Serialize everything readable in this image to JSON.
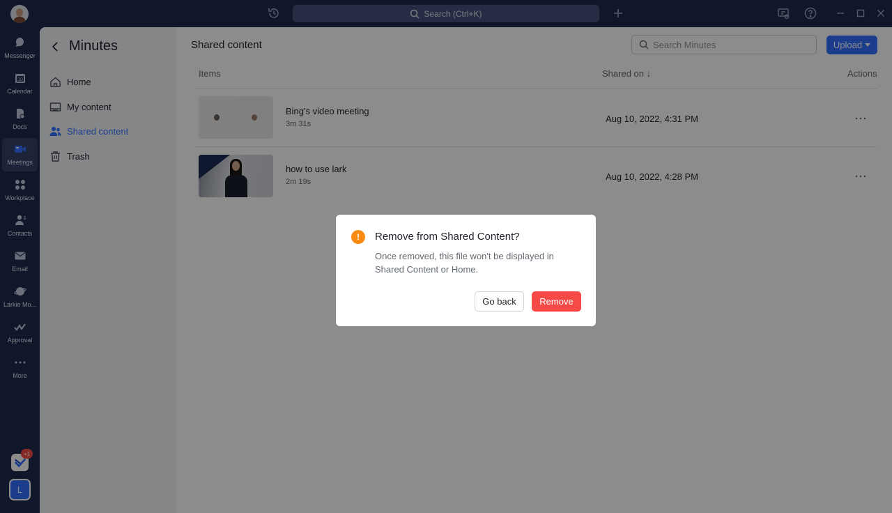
{
  "titlebar": {
    "search_placeholder": "Search (Ctrl+K)"
  },
  "rail": {
    "items": [
      {
        "label": "Messenger",
        "icon": "messenger-icon"
      },
      {
        "label": "Calendar",
        "icon": "calendar-icon",
        "day": "10"
      },
      {
        "label": "Docs",
        "icon": "docs-icon"
      },
      {
        "label": "Meetings",
        "icon": "meetings-icon",
        "active": true
      },
      {
        "label": "Workplace",
        "icon": "workplace-icon"
      },
      {
        "label": "Contacts",
        "icon": "contacts-icon"
      },
      {
        "label": "Email",
        "icon": "email-icon"
      },
      {
        "label": "Larkie Mo...",
        "icon": "larkie-icon"
      },
      {
        "label": "Approval",
        "icon": "approval-icon"
      },
      {
        "label": "More",
        "icon": "more-icon"
      }
    ],
    "app_badge": "+1",
    "user_initial": "L"
  },
  "sidebar": {
    "title": "Minutes",
    "items": [
      {
        "label": "Home",
        "icon": "home-icon"
      },
      {
        "label": "My content",
        "icon": "folder-icon"
      },
      {
        "label": "Shared content",
        "icon": "users-icon",
        "active": true
      },
      {
        "label": "Trash",
        "icon": "trash-icon"
      }
    ]
  },
  "content": {
    "title": "Shared content",
    "search_placeholder": "Search Minutes",
    "upload_label": "Upload",
    "columns": {
      "items": "Items",
      "shared_on": "Shared on ↓",
      "actions": "Actions"
    },
    "rows": [
      {
        "name": "Bing's video meeting",
        "duration": "3m 31s",
        "date": "Aug 10, 2022, 4:31 PM"
      },
      {
        "name": "how to use lark",
        "duration": "2m 19s",
        "date": "Aug 10, 2022, 4:28 PM"
      }
    ]
  },
  "dialog": {
    "icon_text": "!",
    "title": "Remove from Shared Content?",
    "body": "Once removed, this file won't be displayed in Shared Content or Home.",
    "cancel_label": "Go back",
    "confirm_label": "Remove"
  },
  "colors": {
    "accent": "#3370ff",
    "danger": "#f54a45",
    "warning": "#f98a12",
    "rail_bg": "#1f2a4d"
  }
}
